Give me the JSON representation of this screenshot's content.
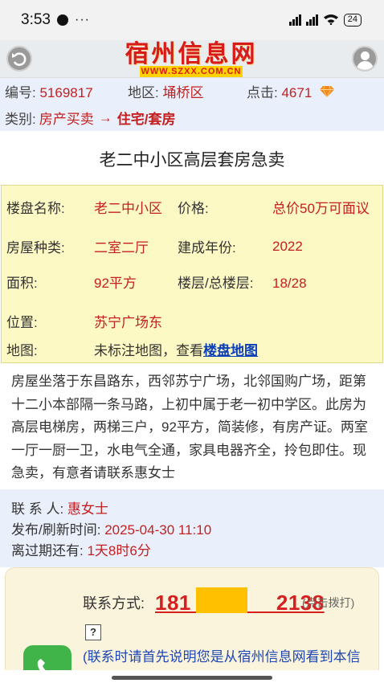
{
  "status_bar": {
    "time": "3:53",
    "more": "···",
    "battery": "24"
  },
  "header": {
    "logo_text": "宿州信息网",
    "logo_url": "WWW.SZXX.COM.CN",
    "back_icon": "back-arrow-icon",
    "user_icon": "user-avatar-icon"
  },
  "meta": {
    "id_label": "编号:",
    "id_value": "5169817",
    "area_label": "地区:",
    "area_value": "埇桥区",
    "clicks_label": "点击:",
    "clicks_value": "4671",
    "category_label": "类别:",
    "category_parent": "房产买卖",
    "category_arrow": "→",
    "category_child": "住宅/套房"
  },
  "title": "老二中小区高层套房急卖",
  "info": {
    "name_label": "楼盘名称:",
    "name_value": "老二中小区",
    "price_label": "价格:",
    "price_value": "总价50万可面议",
    "type_label": "房屋种类:",
    "type_value": "二室二厅",
    "year_label": "建成年份:",
    "year_value": "2022",
    "area_label": "面积:",
    "area_value": "92平方",
    "floor_label": "楼层/总楼层:",
    "floor_value": "18/28",
    "location_label": "位置:",
    "location_value": "苏宁广场东",
    "map_label": "地图:",
    "map_text": "未标注地图，查看",
    "map_link": "楼盘地图"
  },
  "description": "房屋坐落于东昌路东，西邻苏宁广场，北邻国购广场，距第十二小本部隔一条马路，上初中属于老一初中学区。此房为高层电梯房，两梯三户，92平方，简装修，有房产证。两室一厅一厨一卫，水电气全通，家具电器齐全，拎包即住。现急卖，有意者请联系惠女士",
  "contact": {
    "person_label": "联 系 人:",
    "person_value": "惠女士",
    "time_label": "发布/刷新时间:",
    "time_value": "2025-04-30 11:10",
    "expire_label": "离过期还有:",
    "expire_value": "1天8时6分"
  },
  "call": {
    "label": "联系方式:",
    "phone": "181　　　　2138",
    "tap_hint": "(点击拨打)",
    "help": "?",
    "note": "(联系时请首先说明您是从宿州信息网看到本信息的)"
  },
  "colors": {
    "accent_red": "#c42020",
    "meta_bg": "#eaf0fb",
    "info_bg": "#fdf9c5",
    "link_blue": "#0b3fb8",
    "call_bg": "#fbf4dd",
    "phone_green": "#41b449"
  }
}
